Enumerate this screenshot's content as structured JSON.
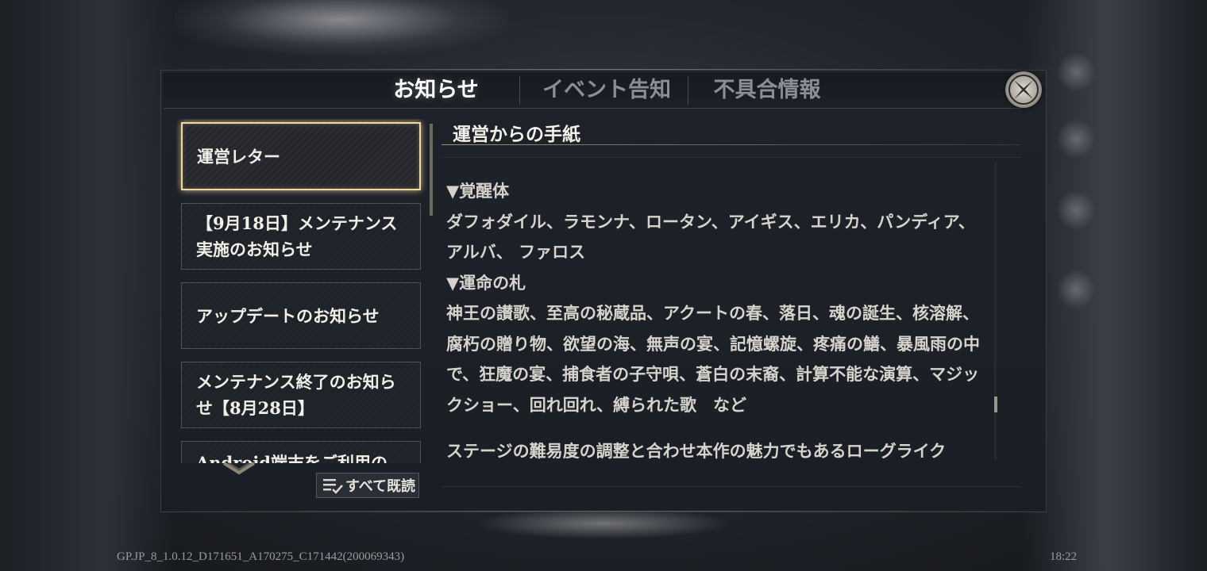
{
  "tabs": [
    {
      "label": "お知らせ",
      "active": true
    },
    {
      "label": "イベント告知",
      "active": false
    },
    {
      "label": "不具合情報",
      "active": false
    }
  ],
  "notices": [
    {
      "title": "運営レター",
      "selected": true
    },
    {
      "title": "【9月18日】メンテナンス実施のお知らせ",
      "selected": false
    },
    {
      "title": "アップデートのお知らせ",
      "selected": false
    },
    {
      "title": "メンテナンス終了のお知らせ【8月28日】",
      "selected": false
    },
    {
      "title": "Android端末をご利用の",
      "selected": false
    }
  ],
  "mark_all_read_label": "すべて既読",
  "content": {
    "title": "運営からの手紙",
    "heading1": "▼覚醒体",
    "para1": "ダフォダイル、ラモンナ、ロータン、アイギス、エリカ、パンディア、アルバ、 ファロス",
    "heading2": "▼運命の札",
    "para2": "神王の讃歌、至高の秘蔵品、アクートの春、落日、魂の誕生、核溶解、腐朽の贈り物、欲望の海、無声の宴、記憶螺旋、疼痛の鱔、暴風雨の中で、狂魔の宴、捕食者の子守唄、蒼白の末裔、計算不能な演算、マジックショー、回れ回れ、縛られた歌　など",
    "para3": "ステージの難易度の調整と合わせ本作の魅力でもあるローグライク"
  },
  "footer": {
    "version": "GP.JP_8_1.0.12_D171651_A170275_C171442(200069343)",
    "time": "18:22"
  },
  "colors": {
    "selected_border": "#f0d9a0",
    "panel_bg": "#1e222a",
    "active_tab_text": "#ffffff",
    "inactive_tab_text": "#8a8e96"
  },
  "icons": [
    "close-icon",
    "chevron-down-icon",
    "mark-all-read-icon"
  ]
}
